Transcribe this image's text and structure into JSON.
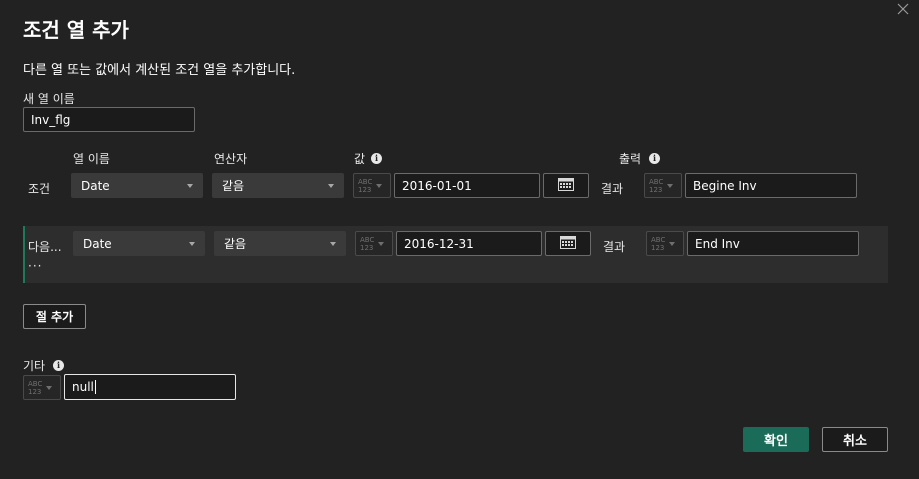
{
  "dialog": {
    "title": "조건 열 추가",
    "description": "다른 열 또는 값에서 계산된 조건 열을 추가합니다.",
    "close_icon": "close-icon"
  },
  "new_column": {
    "label": "새 열 이름",
    "value": "Inv_flg"
  },
  "headers": {
    "column_name": "열 이름",
    "operator": "연산자",
    "value": "값",
    "output": "출력"
  },
  "rows": [
    {
      "prefix": "조건",
      "column": "Date",
      "operator": "같음",
      "type_label_top": "ABC",
      "type_label_bottom": "123",
      "value": "2016-01-01",
      "result_label": "결과",
      "output": "Begine Inv"
    },
    {
      "prefix": "다음...",
      "more": "···",
      "column": "Date",
      "operator": "같음",
      "type_label_top": "ABC",
      "type_label_bottom": "123",
      "value": "2016-12-31",
      "result_label": "결과",
      "output": "End Inv"
    }
  ],
  "add_clause_label": "절 추가",
  "else": {
    "label": "기타",
    "type_label_top": "ABC",
    "type_label_bottom": "123",
    "value": "null"
  },
  "buttons": {
    "ok": "확인",
    "cancel": "취소"
  },
  "colors": {
    "background": "#222222",
    "accent": "#1a6b58",
    "row_highlight": "#2d2d2d",
    "row_border": "#1f7a5c"
  }
}
